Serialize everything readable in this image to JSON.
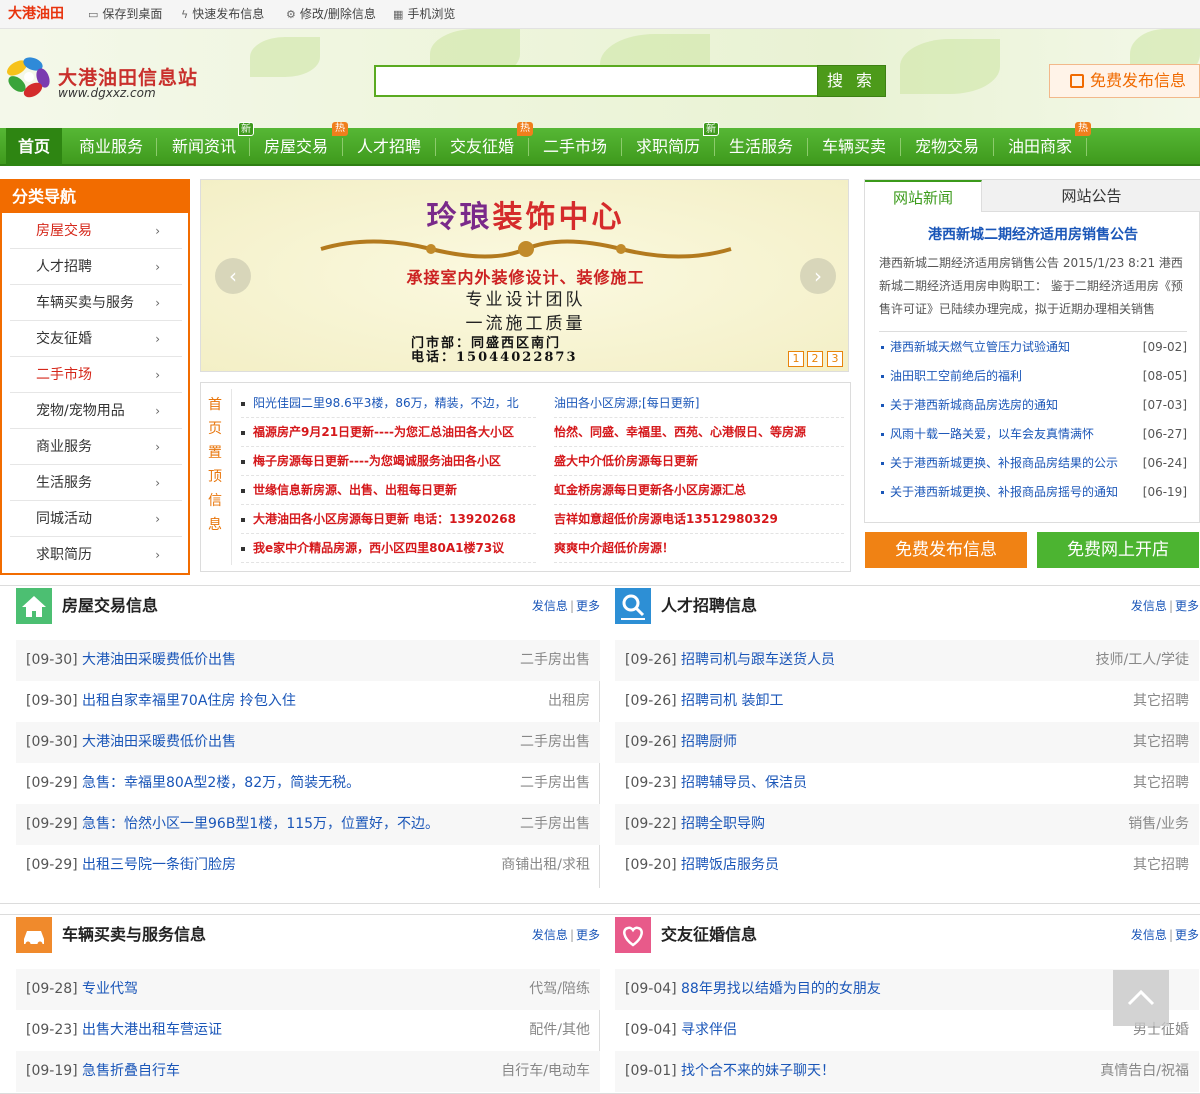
{
  "topbar": {
    "brand": "大港油田",
    "links": [
      "保存到桌面",
      "快速发布信息",
      "修改/删除信息",
      "手机浏览"
    ]
  },
  "header": {
    "logo_text": "大港油田信息站",
    "logo_url": "www.dgxxz.com",
    "search_placeholder": "",
    "search_button": "搜 索",
    "free_post": "免费发布信息"
  },
  "nav": {
    "items": [
      "首页",
      "商业服务",
      "新闻资讯",
      "房屋交易",
      "人才招聘",
      "交友征婚",
      "二手市场",
      "求职简历",
      "生活服务",
      "车辆买卖",
      "宠物交易",
      "油田商家"
    ],
    "badges": {
      "new": "新",
      "hot": "热"
    }
  },
  "catnav": {
    "title": "分类导航",
    "items": [
      "房屋交易",
      "人才招聘",
      "车辆买卖与服务",
      "交友征婚",
      "二手市场",
      "宠物/宠物用品",
      "商业服务",
      "生活服务",
      "同城活动",
      "求职简历"
    ]
  },
  "banner": {
    "title_a": "玲琅",
    "title_b": "装饰中心",
    "line1": "承接室内外装修设计、装修施工",
    "line2": "专业设计团队",
    "line3": "一流施工质量",
    "line4": "门市部：同盛西区南门",
    "line5": "电话：15044022873",
    "pages": [
      "1",
      "2",
      "3"
    ]
  },
  "topinfo": {
    "label": "首页置顶信息",
    "items": [
      {
        "text": "阳光佳园二里98.6平3楼，86万，精装，不边，北",
        "style": "blue"
      },
      {
        "text": "油田各小区房源;[每日更新]",
        "style": "blue"
      },
      {
        "text": "福源房产9月21日更新----为您汇总油田各大小区",
        "style": "red"
      },
      {
        "text": "怡然、同盛、幸福里、西苑、心港假日、等房源",
        "style": "red"
      },
      {
        "text": "梅子房源每日更新----为您竭诚服务油田各小区",
        "style": "red"
      },
      {
        "text": "盛大中介低价房源每日更新",
        "style": "red"
      },
      {
        "text": "世缘信息新房源、出售、出租每日更新",
        "style": "red"
      },
      {
        "text": "虹金桥房源每日更新各小区房源汇总",
        "style": "red"
      },
      {
        "text": "大港油田各小区房源每日更新 电话：13920268",
        "style": "red"
      },
      {
        "text": "吉祥如意超低价房源电话13512980329",
        "style": "red"
      },
      {
        "text": "我e家中介精品房源，西小区四里80A1楼73议",
        "style": "red"
      },
      {
        "text": "爽爽中介超低价房源！",
        "style": "red"
      }
    ]
  },
  "news": {
    "tab_active": "网站新闻",
    "tab_other": "网站公告",
    "headline": "港西新城二期经济适用房销售公告",
    "summary": "港西新城二期经济适用房销售公告 2015/1/23 8:21 港西新城二期经济适用房申购职工： 鉴于二期经济适用房《预售许可证》已陆续办理完成，拟于近期办理相关销售",
    "items": [
      {
        "title": "港西新城天燃气立管压力试验通知",
        "date": "[09-02]"
      },
      {
        "title": "油田职工空前绝后的福利",
        "date": "[08-05]"
      },
      {
        "title": "关于港西新城商品房选房的通知",
        "date": "[07-03]"
      },
      {
        "title": "风雨十载一路关爱，以车会友真情满怀",
        "date": "[06-27]"
      },
      {
        "title": "关于港西新城更换、补报商品房结果的公示",
        "date": "[06-24]"
      },
      {
        "title": "关于港西新城更换、补报商品房摇号的通知",
        "date": "[06-19]"
      }
    ],
    "btn_free": "免费发布信息",
    "btn_shop": "免费网上开店"
  },
  "sections": [
    {
      "title": "房屋交易信息",
      "post": "发信息",
      "more": "更多",
      "icon": "house-icon",
      "color": "#4cbf72",
      "items": [
        {
          "date": "[09-30]",
          "title": "大港油田采暖费低价出售",
          "cat": "二手房出售"
        },
        {
          "date": "[09-30]",
          "title": "出租自家幸福里70A住房 拎包入住",
          "cat": "出租房"
        },
        {
          "date": "[09-30]",
          "title": "大港油田采暖费低价出售",
          "cat": "二手房出售"
        },
        {
          "date": "[09-29]",
          "title": "急售：幸福里80A型2楼，82万，简装无税。",
          "cat": "二手房出售"
        },
        {
          "date": "[09-29]",
          "title": "急售：怡然小区一里96B型1楼，115万，位置好，不边。",
          "cat": "二手房出售"
        },
        {
          "date": "[09-29]",
          "title": "出租三号院一条街门脸房",
          "cat": "商铺出租/求租"
        }
      ]
    },
    {
      "title": "人才招聘信息",
      "post": "发信息",
      "more": "更多",
      "icon": "search-person-icon",
      "color": "#2d8fd5",
      "items": [
        {
          "date": "[09-26]",
          "title": "招聘司机与跟车送货人员",
          "cat": "技师/工人/学徒"
        },
        {
          "date": "[09-26]",
          "title": "招聘司机 装卸工",
          "cat": "其它招聘"
        },
        {
          "date": "[09-26]",
          "title": "招聘厨师",
          "cat": "其它招聘"
        },
        {
          "date": "[09-23]",
          "title": "招聘辅导员、保洁员",
          "cat": "其它招聘"
        },
        {
          "date": "[09-22]",
          "title": "招聘全职导购",
          "cat": "销售/业务"
        },
        {
          "date": "[09-20]",
          "title": "招聘饭店服务员",
          "cat": "其它招聘"
        }
      ]
    },
    {
      "title": "车辆买卖与服务信息",
      "post": "发信息",
      "more": "更多",
      "icon": "car-icon",
      "color": "#f08a2c",
      "items": [
        {
          "date": "[09-28]",
          "title": "专业代驾",
          "cat": "代驾/陪练"
        },
        {
          "date": "[09-23]",
          "title": "出售大港出租车营运证",
          "cat": "配件/其他"
        },
        {
          "date": "[09-19]",
          "title": "急售折叠自行车",
          "cat": "自行车/电动车"
        }
      ]
    },
    {
      "title": "交友征婚信息",
      "post": "发信息",
      "more": "更多",
      "icon": "heart-icon",
      "color": "#e85a8a",
      "items": [
        {
          "date": "[09-04]",
          "title": "88年男找以结婚为目的的女朋友",
          "cat": ""
        },
        {
          "date": "[09-04]",
          "title": "寻求伴侣",
          "cat": "男士征婚"
        },
        {
          "date": "[09-01]",
          "title": "找个合不来的妹子聊天！",
          "cat": "真情告白/祝福"
        }
      ]
    }
  ]
}
